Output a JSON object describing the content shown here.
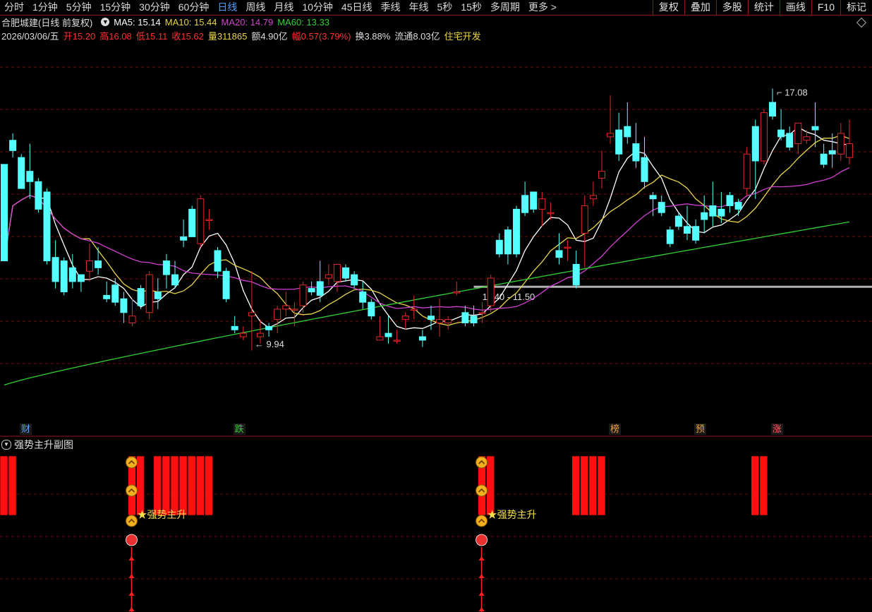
{
  "toolbar": {
    "periods": [
      "分时",
      "1分钟",
      "5分钟",
      "15分钟",
      "30分钟",
      "60分钟",
      "日线",
      "周线",
      "月线",
      "10分钟",
      "45日线",
      "季线",
      "年线",
      "5秒",
      "15秒",
      "多周期",
      "更多 >"
    ],
    "active_period": "日线",
    "tools": [
      "复权",
      "叠加",
      "多股",
      "统计",
      "画线",
      "F10",
      "标记"
    ]
  },
  "stock": {
    "title": "合肥城建(日线 前复权)",
    "ma5_label": "MA5: 15.14",
    "ma10_label": "MA10: 15.44",
    "ma20_label": "MA20: 14.79",
    "ma60_label": "MA60: 13.33",
    "date": "2026/03/06/五",
    "open": "开15.20",
    "high": "高16.08",
    "low": "低15.11",
    "close": "收15.62",
    "volume": "量311865",
    "amount": "额4.90亿",
    "change": "幅0.57(3.79%)",
    "turnover": "换3.88%",
    "float_value": "流通8.03亿",
    "sector": "住宅开发"
  },
  "colors": {
    "up": "#e8262a",
    "down": "#54ffff",
    "ma5": "#ffffff",
    "ma10": "#e8d44a",
    "ma20": "#d040d0",
    "ma60": "#30d030",
    "grid": "#6a1010",
    "support": "#b0b0b0",
    "signal": "#ff1010"
  },
  "chart_data": {
    "type": "candlestick",
    "ylim": [
      8.3,
      18.5
    ],
    "ohlc": [
      [
        15.0,
        14.8,
        14.2,
        12.2
      ],
      [
        15.7,
        15.9,
        15.2,
        15.4
      ],
      [
        15.2,
        15.3,
        14.3,
        14.3
      ],
      [
        14.8,
        15.6,
        14.0,
        14.5
      ],
      [
        14.5,
        14.6,
        13.6,
        13.7
      ],
      [
        14.2,
        14.3,
        12.1,
        12.2
      ],
      [
        12.3,
        12.8,
        11.4,
        11.6
      ],
      [
        12.2,
        12.3,
        11.2,
        11.3
      ],
      [
        12.0,
        12.4,
        11.4,
        11.6
      ],
      [
        11.8,
        11.8,
        11.3,
        11.6
      ],
      [
        11.9,
        12.7,
        11.6,
        12.2
      ],
      [
        12.2,
        12.6,
        11.8,
        12.0
      ],
      [
        11.2,
        11.6,
        11.0,
        11.1
      ],
      [
        11.5,
        11.7,
        10.9,
        11.0
      ],
      [
        11.1,
        11.3,
        10.4,
        10.7
      ],
      [
        10.4,
        11.1,
        10.3,
        10.6
      ],
      [
        11.4,
        11.5,
        10.8,
        10.9
      ],
      [
        10.7,
        11.9,
        10.5,
        11.8
      ],
      [
        11.3,
        11.7,
        10.8,
        11.1
      ],
      [
        12.2,
        12.4,
        11.4,
        11.8
      ],
      [
        11.8,
        12.2,
        11.4,
        11.5
      ],
      [
        12.9,
        13.4,
        12.6,
        12.8
      ],
      [
        13.7,
        13.8,
        12.9,
        12.9
      ],
      [
        12.7,
        14.1,
        12.6,
        14.0
      ],
      [
        13.4,
        13.7,
        13.1,
        13.4
      ],
      [
        12.5,
        12.6,
        11.7,
        11.9
      ],
      [
        11.9,
        12.0,
        11.0,
        11.1
      ],
      [
        10.3,
        10.6,
        10.1,
        10.2
      ],
      [
        10.0,
        10.3,
        9.9,
        10.1
      ],
      [
        10.6,
        11.9,
        9.6,
        10.7
      ],
      [
        10.0,
        10.5,
        9.8,
        10.1
      ],
      [
        10.3,
        10.4,
        10.0,
        10.2
      ],
      [
        10.5,
        10.9,
        10.1,
        10.8
      ],
      [
        10.8,
        11.3,
        10.6,
        10.9
      ],
      [
        10.8,
        11.0,
        10.3,
        10.8
      ],
      [
        10.9,
        11.6,
        10.7,
        11.5
      ],
      [
        11.4,
        11.6,
        11.2,
        11.3
      ],
      [
        11.6,
        12.2,
        11.0,
        11.2
      ],
      [
        11.7,
        12.1,
        11.5,
        11.8
      ],
      [
        11.6,
        12.1,
        11.3,
        12.1
      ],
      [
        12.0,
        12.1,
        11.6,
        11.7
      ],
      [
        11.8,
        11.9,
        11.4,
        11.5
      ],
      [
        11.3,
        11.6,
        10.8,
        11.0
      ],
      [
        11.0,
        11.1,
        10.5,
        10.6
      ],
      [
        9.9,
        10.6,
        9.9,
        10.0
      ],
      [
        10.1,
        10.6,
        9.8,
        10.0
      ],
      [
        9.9,
        10.2,
        9.8,
        9.9
      ],
      [
        10.5,
        10.7,
        10.2,
        10.6
      ],
      [
        10.8,
        11.2,
        10.5,
        10.8
      ],
      [
        10.0,
        10.2,
        9.7,
        9.9
      ],
      [
        10.6,
        10.9,
        10.2,
        10.5
      ],
      [
        10.4,
        11.1,
        10.0,
        10.5
      ],
      [
        10.4,
        10.6,
        10.2,
        10.5
      ],
      [
        11.3,
        11.6,
        11.2,
        11.3
      ],
      [
        10.7,
        10.9,
        10.3,
        10.4
      ],
      [
        10.6,
        10.9,
        10.3,
        10.4
      ],
      [
        10.7,
        11.0,
        10.4,
        10.7
      ],
      [
        10.9,
        11.8,
        10.7,
        11.7
      ],
      [
        12.8,
        13.0,
        12.3,
        12.4
      ],
      [
        13.1,
        13.2,
        12.1,
        12.4
      ],
      [
        13.7,
        13.8,
        12.3,
        12.4
      ],
      [
        14.1,
        14.5,
        13.5,
        13.6
      ],
      [
        14.2,
        14.2,
        13.6,
        13.7
      ],
      [
        13.7,
        14.2,
        13.2,
        14.0
      ],
      [
        13.6,
        13.9,
        13.4,
        13.6
      ],
      [
        12.5,
        13.0,
        12.1,
        12.3
      ],
      [
        12.6,
        12.8,
        12.2,
        12.6
      ],
      [
        12.1,
        12.5,
        11.4,
        11.5
      ],
      [
        13.0,
        14.1,
        12.0,
        13.8
      ],
      [
        14.0,
        14.5,
        13.8,
        14.1
      ],
      [
        14.6,
        15.4,
        14.3,
        14.8
      ],
      [
        15.8,
        17.0,
        15.6,
        15.9
      ],
      [
        16.0,
        16.5,
        15.1,
        15.3
      ],
      [
        16.1,
        16.8,
        15.6,
        15.8
      ],
      [
        15.6,
        16.2,
        14.9,
        15.1
      ],
      [
        15.2,
        15.8,
        14.3,
        14.5
      ],
      [
        14.1,
        14.2,
        13.5,
        14.0
      ],
      [
        13.9,
        14.1,
        13.5,
        13.6
      ],
      [
        13.1,
        13.2,
        12.6,
        12.7
      ],
      [
        13.5,
        13.6,
        13.1,
        13.2
      ],
      [
        13.2,
        13.8,
        12.8,
        13.0
      ],
      [
        13.2,
        13.4,
        12.7,
        12.8
      ],
      [
        13.6,
        14.1,
        13.0,
        13.4
      ],
      [
        13.8,
        14.5,
        13.2,
        13.5
      ],
      [
        13.7,
        14.2,
        13.3,
        13.5
      ],
      [
        14.1,
        14.2,
        13.6,
        13.8
      ],
      [
        13.9,
        14.0,
        13.5,
        13.7
      ],
      [
        14.3,
        15.5,
        14.1,
        15.3
      ],
      [
        16.1,
        16.3,
        14.0,
        15.1
      ],
      [
        15.1,
        16.6,
        15.0,
        16.5
      ],
      [
        16.8,
        17.2,
        16.3,
        16.4
      ],
      [
        16.0,
        16.6,
        15.7,
        15.8
      ],
      [
        15.9,
        16.1,
        15.4,
        15.5
      ],
      [
        15.6,
        16.2,
        15.3,
        16.2
      ],
      [
        15.7,
        16.0,
        15.6,
        15.8
      ],
      [
        16.1,
        16.8,
        15.5,
        16.0
      ],
      [
        15.3,
        15.6,
        14.9,
        15.0
      ],
      [
        15.4,
        15.9,
        14.9,
        15.3
      ],
      [
        15.3,
        16.2,
        15.1,
        15.9
      ],
      [
        15.2,
        16.3,
        15.0,
        15.6
      ]
    ],
    "ma5_label": "MA5",
    "ma10_label": "MA10",
    "ma20_label": "MA20",
    "ma60_label": "MA60",
    "annotations": {
      "high": {
        "value": 17.08,
        "label": "17.08"
      },
      "low": {
        "value": 9.94,
        "label": "9.94"
      },
      "support_range": "11.40 - 11.50",
      "support_level": 11.45
    },
    "events": [
      {
        "label": "财",
        "color": "#5aa0ff",
        "index": 1
      },
      {
        "label": "跌",
        "color": "#30d030",
        "index": 26
      },
      {
        "label": "榜",
        "color": "#f0a040",
        "index": 70
      },
      {
        "label": "预",
        "color": "#f0a040",
        "index": 80
      },
      {
        "label": "涨",
        "color": "#ff6060",
        "index": 89
      }
    ]
  },
  "subchart": {
    "title": "强势主升副图",
    "signal_text": "★强势主升",
    "signal_bars": [
      0,
      1,
      15,
      16,
      18,
      19,
      20,
      21,
      22,
      23,
      24,
      56,
      57,
      67,
      68,
      69,
      70,
      88,
      89
    ],
    "signal_starts": [
      15,
      56
    ]
  }
}
